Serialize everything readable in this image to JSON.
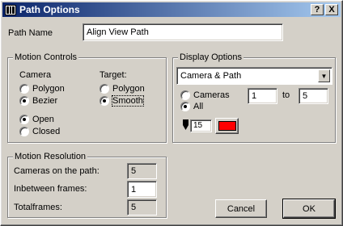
{
  "window": {
    "title": "Path Options",
    "help_label": "?",
    "close_label": "X"
  },
  "path_name": {
    "label": "Path Name",
    "value": "Align View Path"
  },
  "motion_controls": {
    "title": "Motion Controls",
    "camera": {
      "label": "Camera",
      "options": [
        "Polygon",
        "Bezier"
      ],
      "selected": "Bezier"
    },
    "target": {
      "label": "Target:",
      "options": [
        "Polygon",
        "Smooth"
      ],
      "selected": "Smooth"
    },
    "loop": {
      "options": [
        "Open",
        "Closed"
      ],
      "selected": "Open"
    }
  },
  "display_options": {
    "title": "Display Options",
    "mode_selected": "Camera & Path",
    "range": {
      "cameras_label": "Cameras",
      "all_label": "All",
      "selected": "All",
      "from": "1",
      "to_label": "to",
      "to": "5"
    },
    "line_width": "15",
    "path_color": "#ff0000",
    "icons": {
      "pen": "pen-icon"
    }
  },
  "motion_resolution": {
    "title": "Motion Resolution",
    "cameras_on_path_label": "Cameras on the path:",
    "cameras_on_path": "5",
    "inbetween_label": "Inbetween frames:",
    "inbetween": "1",
    "totalframes_label": "Totalframes:",
    "totalframes": "5"
  },
  "buttons": {
    "cancel": "Cancel",
    "ok": "OK"
  }
}
